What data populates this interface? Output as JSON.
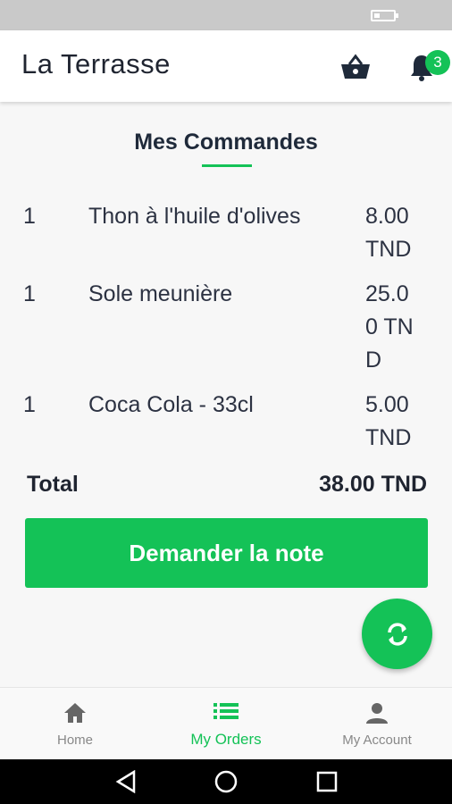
{
  "status_bar": {
    "battery_level": 0.3
  },
  "app_bar": {
    "title": "La Terrasse",
    "basket_icon": "basket-icon",
    "bell_icon": "bell-icon",
    "notification_count": "3"
  },
  "page": {
    "title": "Mes Commandes"
  },
  "orders": [
    {
      "qty": "1",
      "name": "Thon à l'huile d'olives",
      "price": "8.00 TND"
    },
    {
      "qty": "1",
      "name": "Sole meunière",
      "price": "25.00 TND"
    },
    {
      "qty": "1",
      "name": "Coca Cola - 33cl",
      "price": "5.00 TND"
    }
  ],
  "total": {
    "label": "Total",
    "value": "38.00 TND"
  },
  "note_button": {
    "label": "Demander la note"
  },
  "fab": {
    "icon": "refresh-icon"
  },
  "bottom_nav": {
    "items": [
      {
        "label": "Home",
        "icon": "home-icon"
      },
      {
        "label": "My Orders",
        "icon": "list-icon"
      },
      {
        "label": "My Account",
        "icon": "person-icon"
      }
    ],
    "active": "My Orders"
  },
  "colors": {
    "accent": "#14c257",
    "text": "#2c3242"
  }
}
